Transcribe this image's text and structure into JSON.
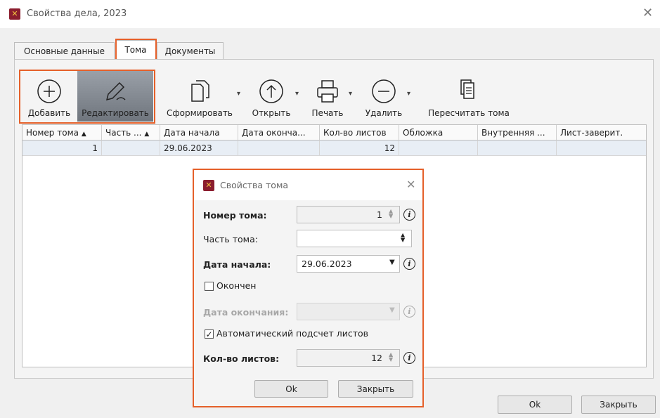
{
  "window": {
    "title": "Свойства дела, 2023"
  },
  "tabs": [
    {
      "label": "Основные данные"
    },
    {
      "label": "Тома"
    },
    {
      "label": "Документы"
    }
  ],
  "toolbar": {
    "add": "Добавить",
    "edit": "Редактировать",
    "form": "Сформировать",
    "open": "Открыть",
    "print": "Печать",
    "delete": "Удалить",
    "recalc": "Пересчитать тома"
  },
  "grid": {
    "columns": [
      "Номер тома",
      "Часть ...",
      "Дата начала",
      "Дата оконча...",
      "Кол-во листов",
      "Обложка",
      "Внутренняя ...",
      "Лист-заверит."
    ],
    "rows": [
      {
        "volume": "1",
        "part": "",
        "start": "29.06.2023",
        "end": "",
        "sheets": "12",
        "cover": "",
        "inner": "",
        "cert": ""
      }
    ]
  },
  "footer": {
    "ok": "Ok",
    "close": "Закрыть"
  },
  "dialog": {
    "title": "Свойства тома",
    "volume_label": "Номер тома:",
    "volume_value": "1",
    "part_label": "Часть тома:",
    "part_value": "",
    "start_label": "Дата начала:",
    "start_value": "29.06.2023",
    "finished_label": "Окончен",
    "finished_checked": false,
    "end_label": "Дата окончания:",
    "end_value": "",
    "auto_label": "Автоматический подсчет листов",
    "auto_checked": true,
    "sheets_label": "Кол-во листов:",
    "sheets_value": "12",
    "ok": "Ok",
    "close": "Закрыть"
  },
  "colors": {
    "accent": "#e5602a",
    "selected_row": "#e8eef5",
    "icon_brand": "#8b1d2e"
  }
}
